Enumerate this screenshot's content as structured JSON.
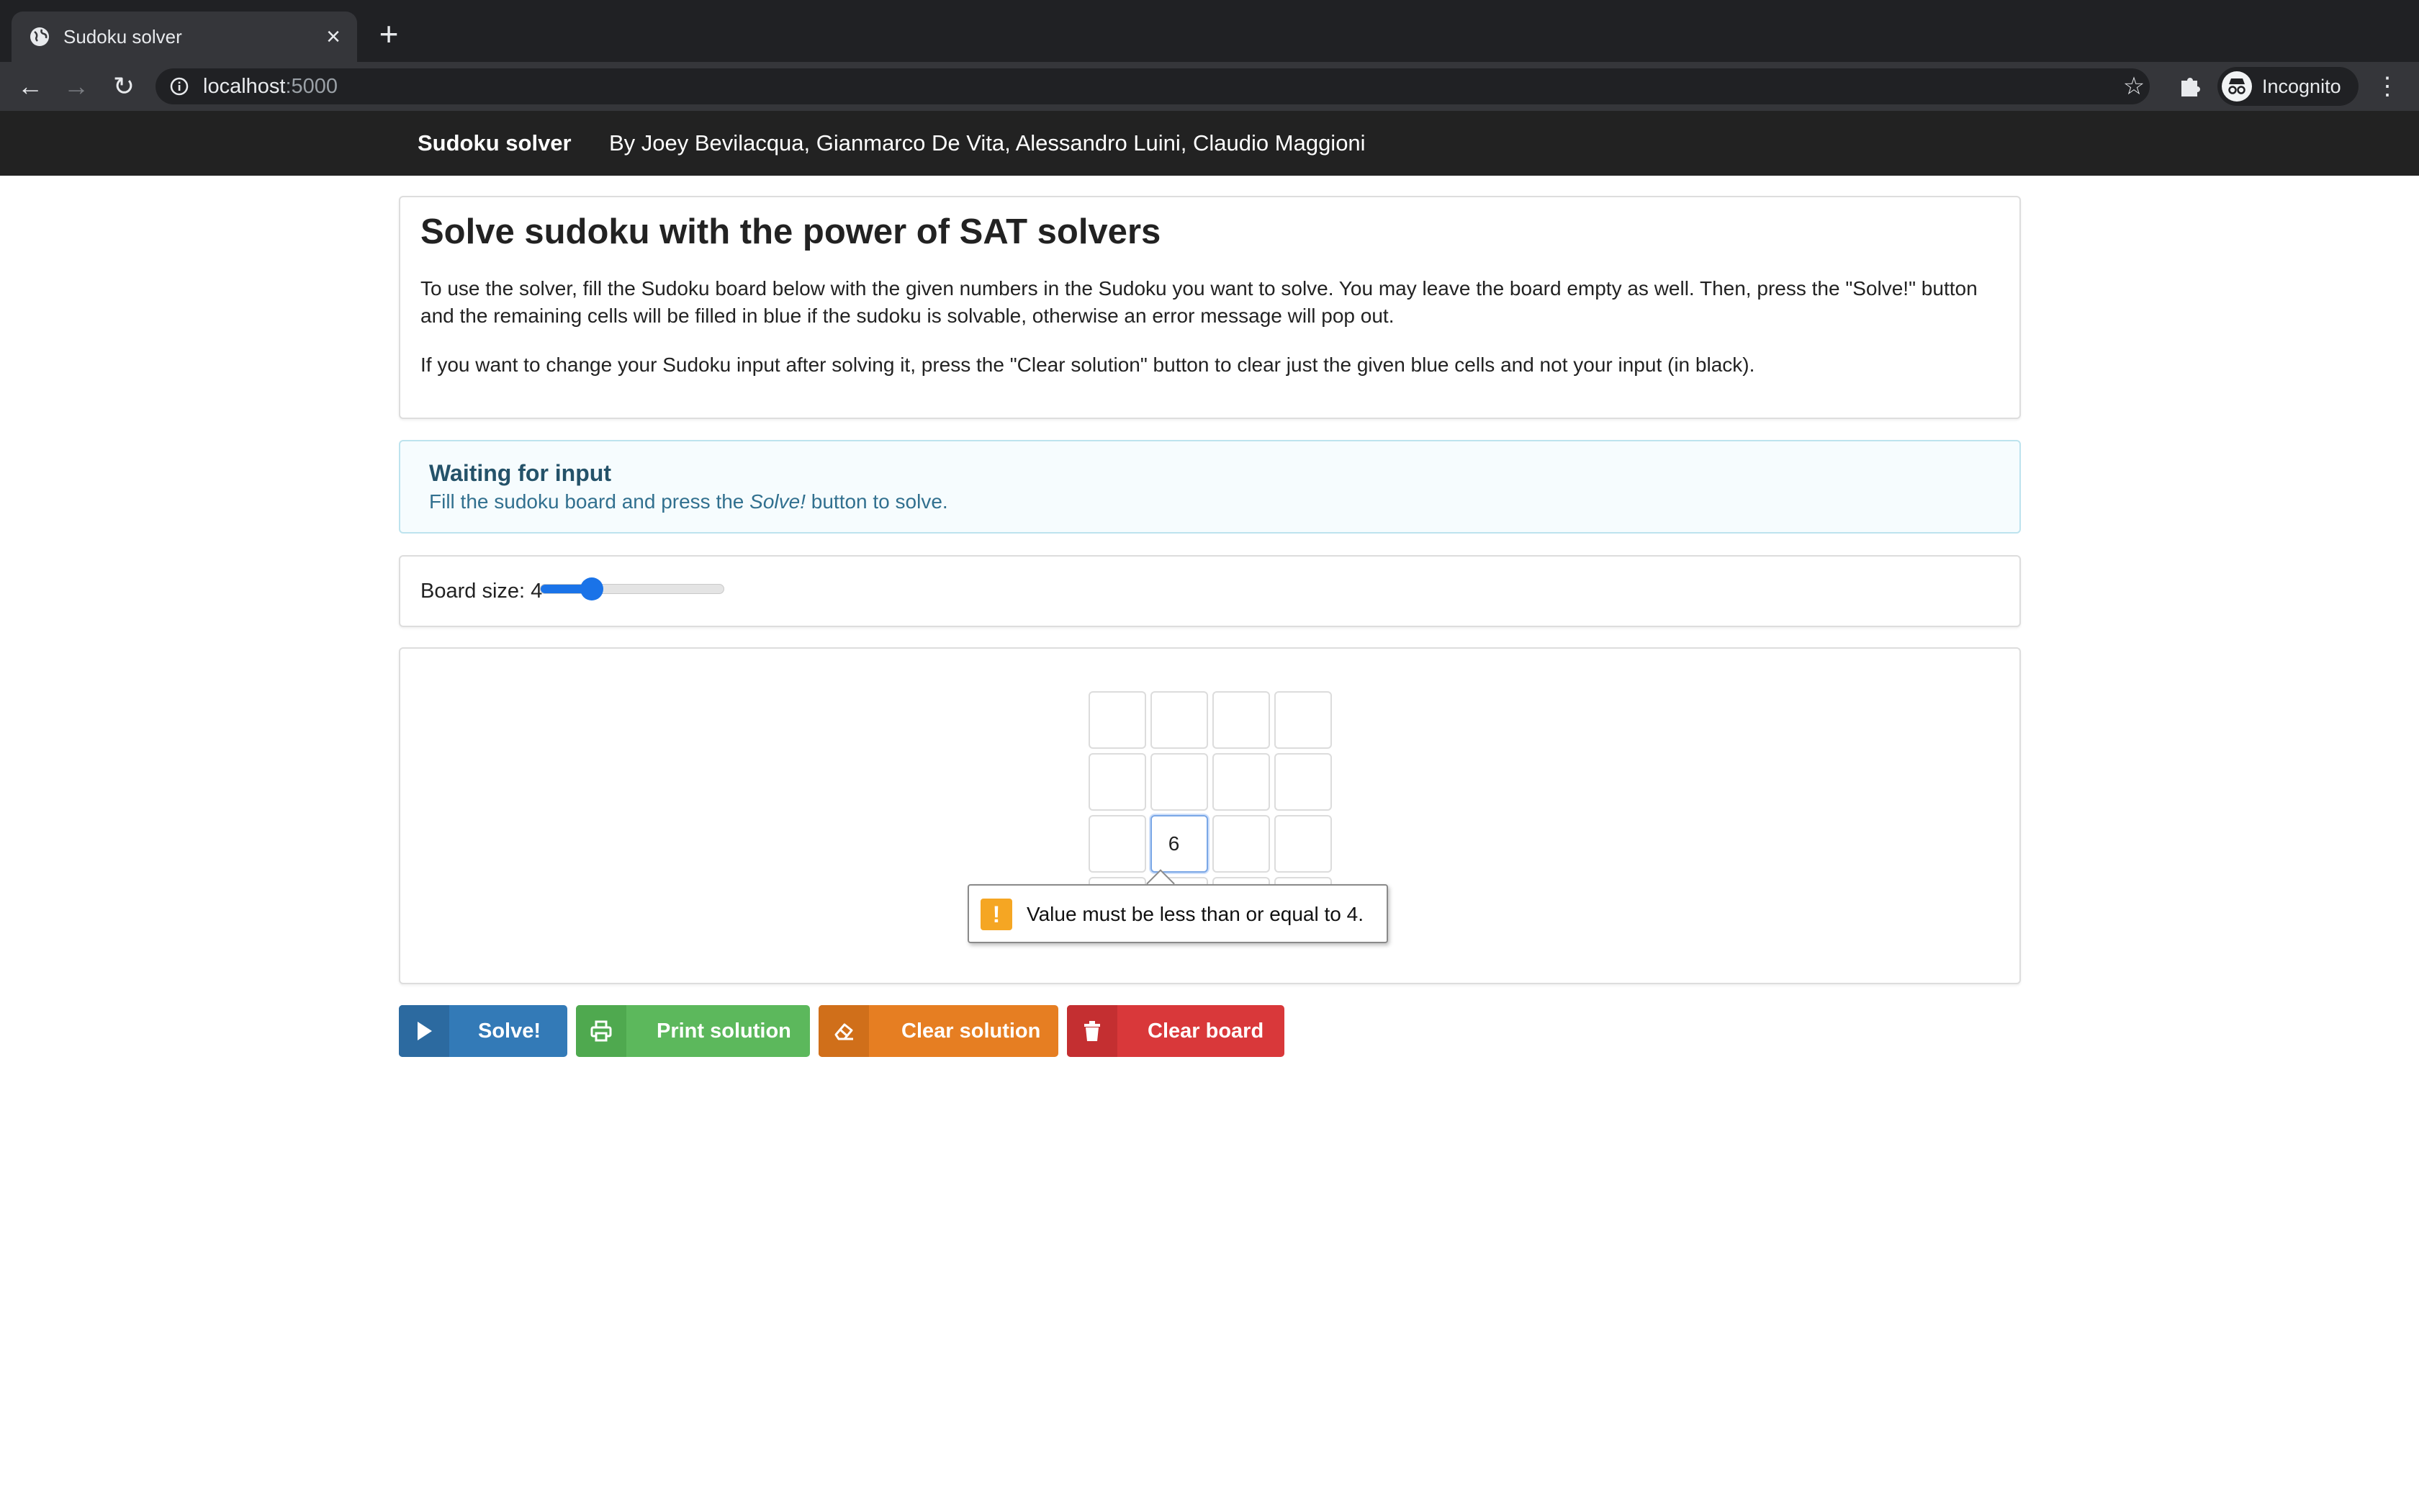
{
  "browser": {
    "tab_title": "Sudoku solver",
    "url_host": "localhost",
    "url_port": ":5000",
    "profile_label": "Incognito"
  },
  "navbar": {
    "brand": "Sudoku solver",
    "authors": "By Joey Bevilacqua, Gianmarco De Vita, Alessandro Luini, Claudio Maggioni"
  },
  "intro": {
    "title": "Solve sudoku with the power of SAT solvers",
    "paragraph1": "To use the solver, fill the Sudoku board below with the given numbers in the Sudoku you want to solve. You may leave the board empty as well. Then, press the \"Solve!\" button and the remaining cells will be filled in blue if the sudoku is solvable, otherwise an error message will pop out.",
    "paragraph2": "If you want to change your Sudoku input after solving it, press the \"Clear solution\" button to clear just the given blue cells and not your input (in black)."
  },
  "status": {
    "title": "Waiting for input",
    "text_before": "Fill the sudoku board and press the ",
    "text_em": "Solve!",
    "text_after": " button to solve."
  },
  "board_size": {
    "label": "Board size: 4",
    "value": 4,
    "slider_fraction": 0.28
  },
  "board": {
    "rows": [
      [
        "",
        "",
        "",
        ""
      ],
      [
        "",
        "",
        "",
        ""
      ],
      [
        "",
        "6",
        "",
        ""
      ],
      [
        "",
        "",
        "",
        ""
      ]
    ]
  },
  "validation": {
    "message": "Value must be less than or equal to 4."
  },
  "buttons": {
    "solve": "Solve!",
    "print": "Print solution",
    "clear_solution": "Clear solution",
    "clear_board": "Clear board"
  },
  "colors": {
    "solve": "#337ab7",
    "print": "#5cb85c",
    "clear_solution": "#e67e22",
    "clear_board": "#d9383a",
    "warning": "#f5a623"
  }
}
